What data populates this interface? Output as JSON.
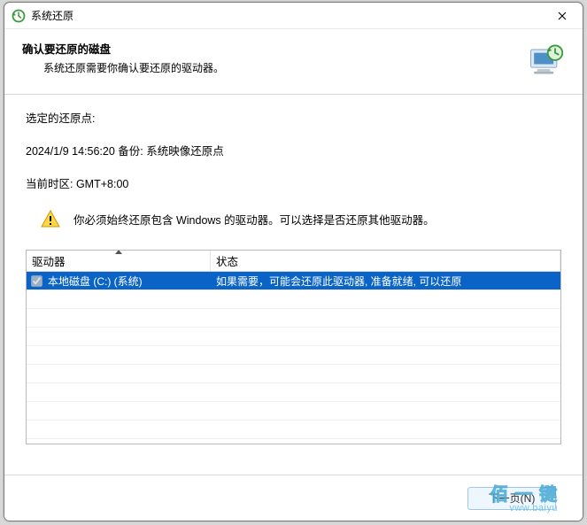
{
  "window": {
    "title": "系统还原"
  },
  "header": {
    "title": "确认要还原的磁盘",
    "subtitle": "系统还原需要你确认要还原的驱动器。"
  },
  "content": {
    "selected_point_label": "选定的还原点:",
    "selected_point_value": "2024/1/9 14:56:20 备份: 系统映像还原点",
    "timezone_line": "当前时区: GMT+8:00",
    "warning_text": "你必须始终还原包含 Windows 的驱动器。可以选择是否还原其他驱动器。"
  },
  "grid": {
    "columns": {
      "drive": "驱动器",
      "status": "状态"
    },
    "rows": [
      {
        "checked": true,
        "disabled": true,
        "selected": true,
        "drive": "本地磁盘 (C:) (系统)",
        "status": "如果需要，可能会还原此驱动器, 准备就绪, 可以还原"
      }
    ]
  },
  "footer": {
    "next_label": "下一页(N)"
  },
  "watermark": {
    "line1": "佰 一 键",
    "line2": "vww.baiyu"
  }
}
